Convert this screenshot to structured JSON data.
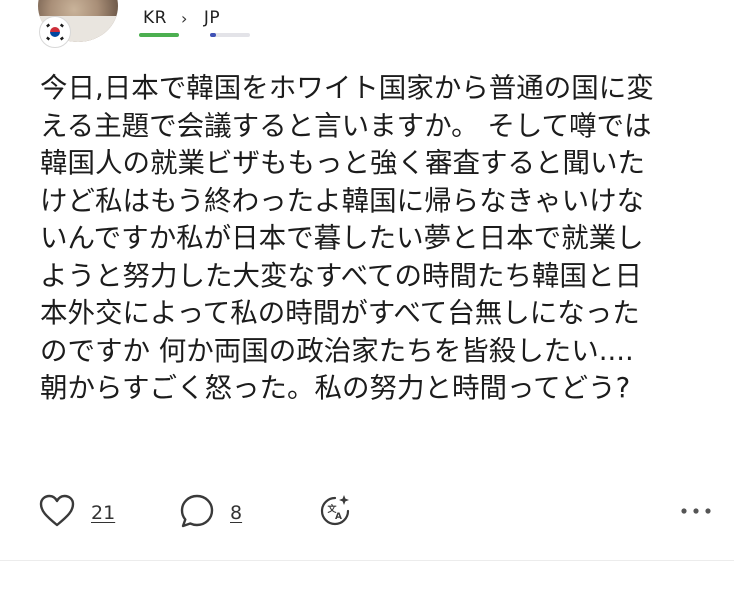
{
  "author": {
    "avatar_icon": "user-avatar",
    "flag_icon": "south-korea-flag-icon"
  },
  "languages": {
    "from": "KR",
    "separator_icon": "chevron-right-icon",
    "to": "JP",
    "from_progress": 1.0,
    "to_progress": 0.15,
    "from_color": "#4caf50",
    "to_color": "#3f51b5"
  },
  "post": {
    "lines": [
      "今日,日本で韓国をホワイト国家から普通の国に変",
      "える主題で会議すると言いますか。 そして噂では",
      "韓国人の就業ビザももっと強く審査すると聞いた",
      "けど私はもう終わったよ韓国に帰らなきゃいけな",
      "いんですか私が日本で暮したい夢と日本で就業し",
      "ようと努力した大変なすべての時間たち韓国と日",
      "本外交によって私の時間がすべて台無しになった",
      "のですか 何か両国の政治家たちを皆殺したい....",
      "朝からすごく怒った。私の努力と時間ってどう?"
    ]
  },
  "actions": {
    "like_icon": "heart-icon",
    "like_count": "21",
    "comment_icon": "comment-bubble-icon",
    "comment_count": "8",
    "translate_icon": "translate-icon",
    "more_icon": "more-horizontal-icon"
  }
}
